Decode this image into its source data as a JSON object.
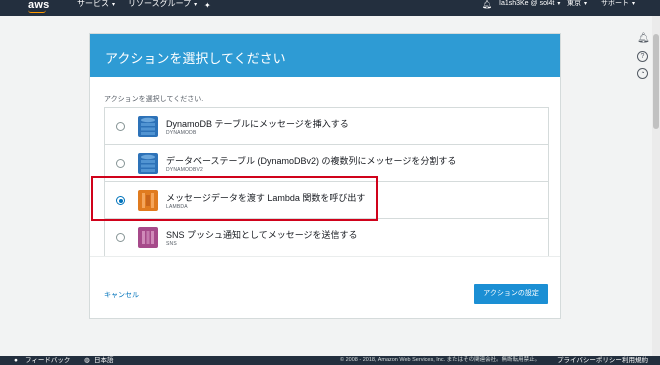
{
  "topnav": {
    "logo": "aws",
    "services": "サービス",
    "resource_groups": "リソースグループ",
    "account": "Ia1sh3Ke @ sol4t",
    "region": "東京",
    "support": "サポート"
  },
  "modal": {
    "title": "アクションを選択してください",
    "prompt": "アクションを選択してください.",
    "options": [
      {
        "title": "DynamoDB テーブルにメッセージを挿入する",
        "sub": "DYNAMODB",
        "icon": "dynamodb-icon",
        "selected": false
      },
      {
        "title": "データベーステーブル (DynamoDBv2) の複数列にメッセージを分割する",
        "sub": "DYNAMODBV2",
        "icon": "dynamodb-icon",
        "selected": false
      },
      {
        "title": "メッセージデータを渡す Lambda 関数を呼び出す",
        "sub": "LAMBDA",
        "icon": "lambda-icon",
        "selected": true
      },
      {
        "title": "SNS プッシュ通知としてメッセージを送信する",
        "sub": "SNS",
        "icon": "sns-icon",
        "selected": false
      }
    ],
    "cancel_label": "キャンセル",
    "primary_label": "アクションの設定"
  },
  "footer": {
    "feedback": "フィードバック",
    "language": "日本語",
    "copyright": "© 2008 - 2018, Amazon Web Services, Inc. またはその関連会社。無断転用禁止。",
    "privacy": "プライバシーポリシー",
    "terms": "利用規約"
  },
  "colors": {
    "nav_bg": "#232f3e",
    "header_blue": "#2e9bd4",
    "button_blue": "#1b8fd4",
    "highlight_red": "#d0021b",
    "dynamodb_blue": "#2d72b8",
    "lambda_orange": "#e07b1f",
    "sns_purple": "#a64a8a"
  }
}
